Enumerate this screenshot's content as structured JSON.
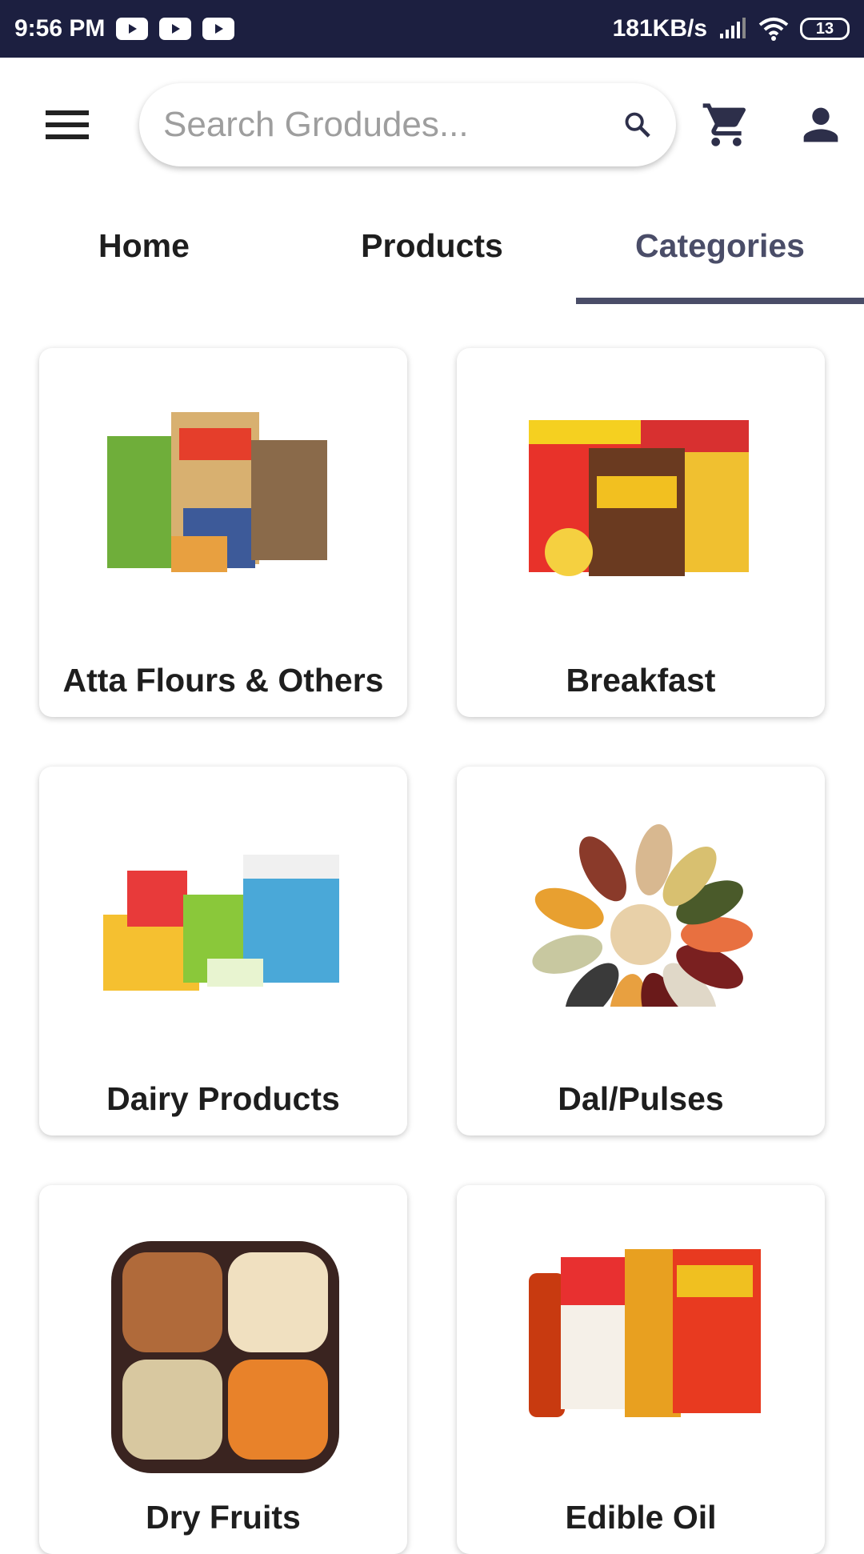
{
  "status_bar": {
    "time": "9:56 PM",
    "notifications": [
      "youtube-icon",
      "youtube-icon",
      "youtube-icon"
    ],
    "network_speed": "181KB/s",
    "battery": "13"
  },
  "header": {
    "search_placeholder": "Search Grodudes...",
    "search_value": "",
    "icons": [
      "menu-icon",
      "search-icon",
      "cart-icon",
      "account-icon"
    ]
  },
  "tabs": [
    {
      "label": "Home",
      "active": false
    },
    {
      "label": "Products",
      "active": false
    },
    {
      "label": "Categories",
      "active": true
    }
  ],
  "accent_color": "#4a4d68",
  "categories": [
    {
      "label": "Atta Flours & Others"
    },
    {
      "label": "Breakfast"
    },
    {
      "label": "Dairy Products"
    },
    {
      "label": "Dal/Pulses"
    },
    {
      "label": "Dry Fruits"
    },
    {
      "label": "Edible Oil"
    }
  ]
}
